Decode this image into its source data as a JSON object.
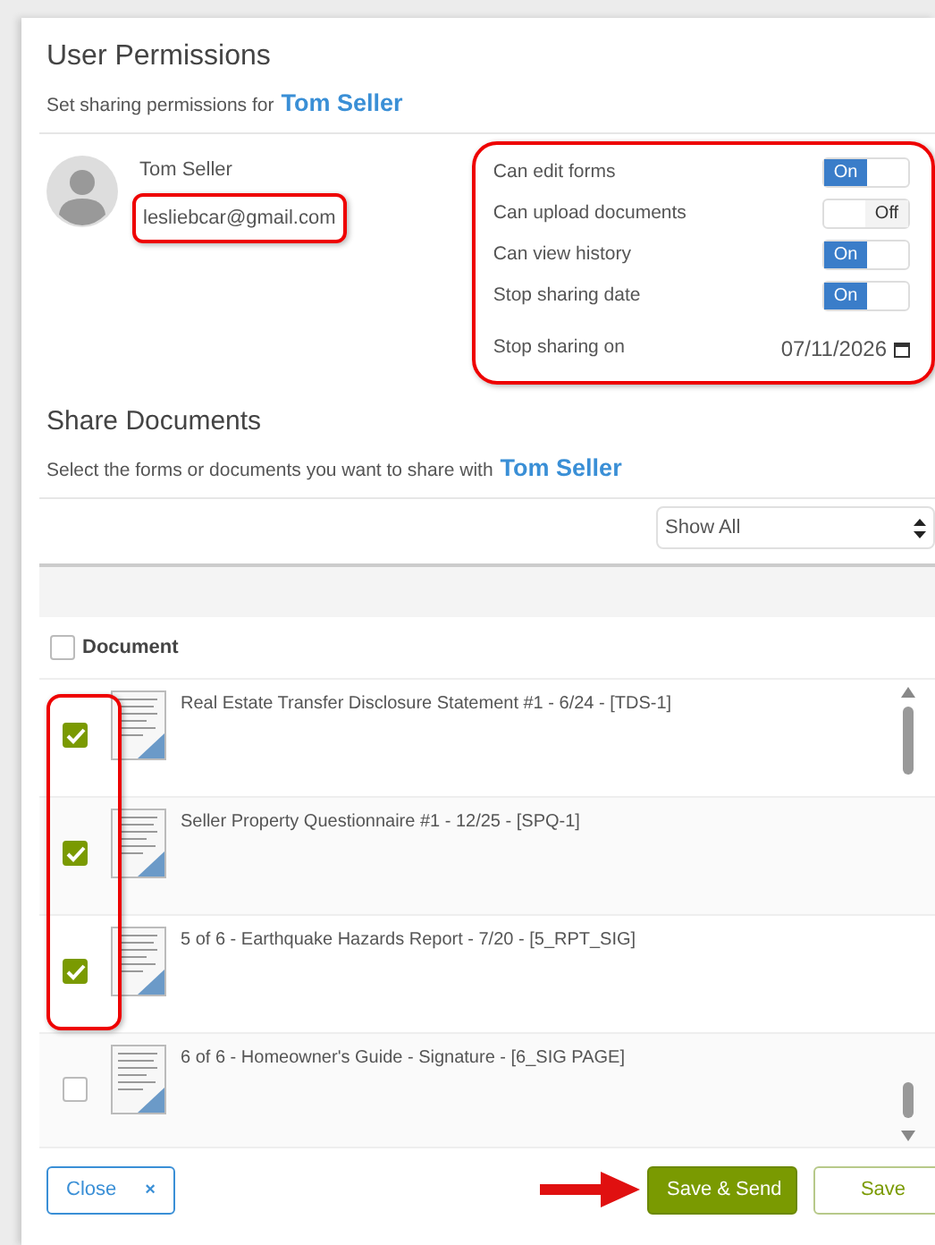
{
  "title": "User Permissions",
  "subtitle": {
    "text": "Set sharing permissions for",
    "name": "Tom Seller"
  },
  "user": {
    "name": "Tom Seller",
    "email": "lesliebcar@gmail.com",
    "email_highlighted": true
  },
  "permissions": {
    "highlighted": true,
    "toggles": [
      {
        "label": "Can edit forms",
        "on": true,
        "text": "On"
      },
      {
        "label": "Can upload documents",
        "on": false,
        "text": "Off"
      },
      {
        "label": "Can view history",
        "on": true,
        "text": "On"
      },
      {
        "label": "Stop sharing date",
        "on": true,
        "text": "On"
      }
    ],
    "date": {
      "label": "Stop sharing on",
      "value": "07/11/2026"
    }
  },
  "share": {
    "title": "Share Documents",
    "text": "Select the forms or documents you want to share with",
    "name": "Tom Seller"
  },
  "filter": {
    "value": "Show All"
  },
  "documents": {
    "header": "Document",
    "header_checked": false,
    "checkboxes_highlighted": true,
    "rows": [
      {
        "title": "Real Estate Transfer Disclosure Statement #1 - 6/24 - [TDS-1]",
        "checked": true
      },
      {
        "title": "Seller Property Questionnaire #1 - 12/25 - [SPQ-1]",
        "checked": true
      },
      {
        "title": "5 of 6 - Earthquake Hazards Report - 7/20 - [5_RPT_SIG]",
        "checked": true
      },
      {
        "title": "6 of 6 - Homeowner's Guide - Signature - [6_SIG PAGE]",
        "checked": false
      }
    ]
  },
  "footer": {
    "close": "Close",
    "close_icon": "×",
    "primary": "Save & Send",
    "primary_arrow": true,
    "secondary": "Save"
  }
}
